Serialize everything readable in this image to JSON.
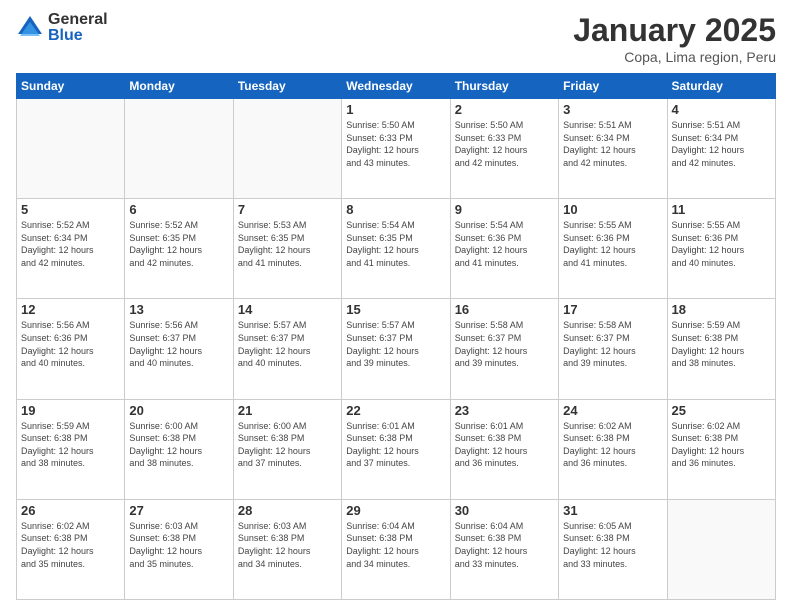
{
  "logo": {
    "general": "General",
    "blue": "Blue"
  },
  "header": {
    "title": "January 2025",
    "subtitle": "Copa, Lima region, Peru"
  },
  "weekdays": [
    "Sunday",
    "Monday",
    "Tuesday",
    "Wednesday",
    "Thursday",
    "Friday",
    "Saturday"
  ],
  "weeks": [
    [
      {
        "day": "",
        "info": ""
      },
      {
        "day": "",
        "info": ""
      },
      {
        "day": "",
        "info": ""
      },
      {
        "day": "1",
        "info": "Sunrise: 5:50 AM\nSunset: 6:33 PM\nDaylight: 12 hours\nand 43 minutes."
      },
      {
        "day": "2",
        "info": "Sunrise: 5:50 AM\nSunset: 6:33 PM\nDaylight: 12 hours\nand 42 minutes."
      },
      {
        "day": "3",
        "info": "Sunrise: 5:51 AM\nSunset: 6:34 PM\nDaylight: 12 hours\nand 42 minutes."
      },
      {
        "day": "4",
        "info": "Sunrise: 5:51 AM\nSunset: 6:34 PM\nDaylight: 12 hours\nand 42 minutes."
      }
    ],
    [
      {
        "day": "5",
        "info": "Sunrise: 5:52 AM\nSunset: 6:34 PM\nDaylight: 12 hours\nand 42 minutes."
      },
      {
        "day": "6",
        "info": "Sunrise: 5:52 AM\nSunset: 6:35 PM\nDaylight: 12 hours\nand 42 minutes."
      },
      {
        "day": "7",
        "info": "Sunrise: 5:53 AM\nSunset: 6:35 PM\nDaylight: 12 hours\nand 41 minutes."
      },
      {
        "day": "8",
        "info": "Sunrise: 5:54 AM\nSunset: 6:35 PM\nDaylight: 12 hours\nand 41 minutes."
      },
      {
        "day": "9",
        "info": "Sunrise: 5:54 AM\nSunset: 6:36 PM\nDaylight: 12 hours\nand 41 minutes."
      },
      {
        "day": "10",
        "info": "Sunrise: 5:55 AM\nSunset: 6:36 PM\nDaylight: 12 hours\nand 41 minutes."
      },
      {
        "day": "11",
        "info": "Sunrise: 5:55 AM\nSunset: 6:36 PM\nDaylight: 12 hours\nand 40 minutes."
      }
    ],
    [
      {
        "day": "12",
        "info": "Sunrise: 5:56 AM\nSunset: 6:36 PM\nDaylight: 12 hours\nand 40 minutes."
      },
      {
        "day": "13",
        "info": "Sunrise: 5:56 AM\nSunset: 6:37 PM\nDaylight: 12 hours\nand 40 minutes."
      },
      {
        "day": "14",
        "info": "Sunrise: 5:57 AM\nSunset: 6:37 PM\nDaylight: 12 hours\nand 40 minutes."
      },
      {
        "day": "15",
        "info": "Sunrise: 5:57 AM\nSunset: 6:37 PM\nDaylight: 12 hours\nand 39 minutes."
      },
      {
        "day": "16",
        "info": "Sunrise: 5:58 AM\nSunset: 6:37 PM\nDaylight: 12 hours\nand 39 minutes."
      },
      {
        "day": "17",
        "info": "Sunrise: 5:58 AM\nSunset: 6:37 PM\nDaylight: 12 hours\nand 39 minutes."
      },
      {
        "day": "18",
        "info": "Sunrise: 5:59 AM\nSunset: 6:38 PM\nDaylight: 12 hours\nand 38 minutes."
      }
    ],
    [
      {
        "day": "19",
        "info": "Sunrise: 5:59 AM\nSunset: 6:38 PM\nDaylight: 12 hours\nand 38 minutes."
      },
      {
        "day": "20",
        "info": "Sunrise: 6:00 AM\nSunset: 6:38 PM\nDaylight: 12 hours\nand 38 minutes."
      },
      {
        "day": "21",
        "info": "Sunrise: 6:00 AM\nSunset: 6:38 PM\nDaylight: 12 hours\nand 37 minutes."
      },
      {
        "day": "22",
        "info": "Sunrise: 6:01 AM\nSunset: 6:38 PM\nDaylight: 12 hours\nand 37 minutes."
      },
      {
        "day": "23",
        "info": "Sunrise: 6:01 AM\nSunset: 6:38 PM\nDaylight: 12 hours\nand 36 minutes."
      },
      {
        "day": "24",
        "info": "Sunrise: 6:02 AM\nSunset: 6:38 PM\nDaylight: 12 hours\nand 36 minutes."
      },
      {
        "day": "25",
        "info": "Sunrise: 6:02 AM\nSunset: 6:38 PM\nDaylight: 12 hours\nand 36 minutes."
      }
    ],
    [
      {
        "day": "26",
        "info": "Sunrise: 6:02 AM\nSunset: 6:38 PM\nDaylight: 12 hours\nand 35 minutes."
      },
      {
        "day": "27",
        "info": "Sunrise: 6:03 AM\nSunset: 6:38 PM\nDaylight: 12 hours\nand 35 minutes."
      },
      {
        "day": "28",
        "info": "Sunrise: 6:03 AM\nSunset: 6:38 PM\nDaylight: 12 hours\nand 34 minutes."
      },
      {
        "day": "29",
        "info": "Sunrise: 6:04 AM\nSunset: 6:38 PM\nDaylight: 12 hours\nand 34 minutes."
      },
      {
        "day": "30",
        "info": "Sunrise: 6:04 AM\nSunset: 6:38 PM\nDaylight: 12 hours\nand 33 minutes."
      },
      {
        "day": "31",
        "info": "Sunrise: 6:05 AM\nSunset: 6:38 PM\nDaylight: 12 hours\nand 33 minutes."
      },
      {
        "day": "",
        "info": ""
      }
    ]
  ]
}
